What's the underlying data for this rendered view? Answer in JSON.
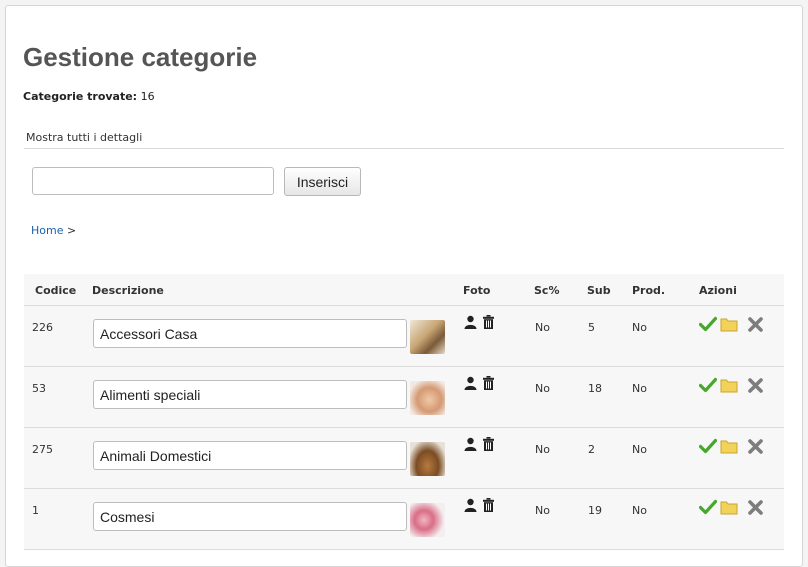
{
  "page": {
    "title": "Gestione categorie",
    "found_label": "Categorie trovate:",
    "found_count": "16",
    "details_link": "Mostra tutti i dettagli"
  },
  "search": {
    "value": "",
    "placeholder": "",
    "insert_label": "Inserisci"
  },
  "breadcrumb": {
    "home": "Home",
    "separator": ">"
  },
  "table": {
    "columns": [
      "Codice",
      "Descrizione",
      "Foto",
      "Sc%",
      "Sub",
      "Prod.",
      "Azioni"
    ],
    "rows": [
      {
        "codice": "226",
        "descrizione": "Accessori Casa",
        "sc": "No",
        "sub": "5",
        "prod": "No"
      },
      {
        "codice": "53",
        "descrizione": "Alimenti speciali",
        "sc": "No",
        "sub": "18",
        "prod": "No"
      },
      {
        "codice": "275",
        "descrizione": "Animali Domestici",
        "sc": "No",
        "sub": "2",
        "prod": "No"
      },
      {
        "codice": "1",
        "descrizione": "Cosmesi",
        "sc": "No",
        "sub": "19",
        "prod": "No"
      }
    ]
  },
  "icons": {
    "photo_person": "person-icon",
    "photo_delete": "trash-icon",
    "action_confirm": "check-icon",
    "action_folder": "folder-icon",
    "action_delete": "close-x-icon"
  },
  "colors": {
    "link": "#1a62a8",
    "check": "#47a62c",
    "folder": "#f3d25a",
    "x": "#8c8c8c"
  }
}
